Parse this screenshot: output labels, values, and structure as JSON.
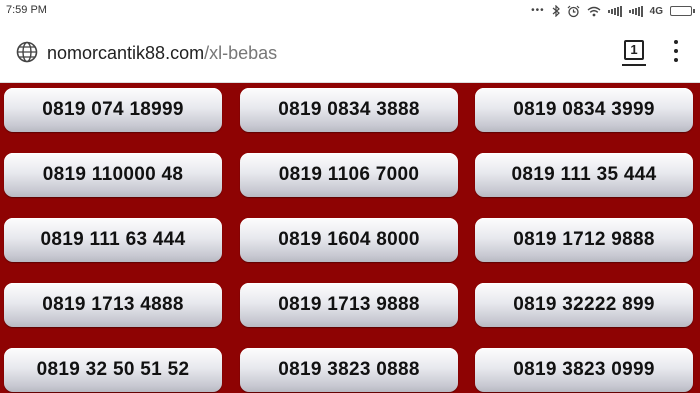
{
  "status_bar": {
    "time": "7:59 PM",
    "icons": [
      "more-dots-icon",
      "bluetooth-icon",
      "alarm-icon",
      "wifi-icon",
      "signal-icon",
      "signal-icon",
      "4g-icon",
      "battery-icon"
    ],
    "network_label": "4G"
  },
  "browser": {
    "url_host": "nomorcantik88.com",
    "url_path": "/xl-bebas",
    "tab_count": "1"
  },
  "numbers": [
    [
      "0819 074 18999",
      "0819 0834 3888",
      "0819 0834 3999"
    ],
    [
      "0819 110000 48",
      "0819 1106 7000",
      "0819 111 35 444"
    ],
    [
      "0819 111 63 444",
      "0819 1604 8000",
      "0819 1712 9888"
    ],
    [
      "0819 1713 4888",
      "0819 1713 9888",
      "0819 32222 899"
    ],
    [
      "0819 32 50 51 52",
      "0819 3823 0888",
      "0819 3823 0999"
    ]
  ],
  "colors": {
    "page_background": "#8e0303",
    "button_text": "#111111"
  }
}
